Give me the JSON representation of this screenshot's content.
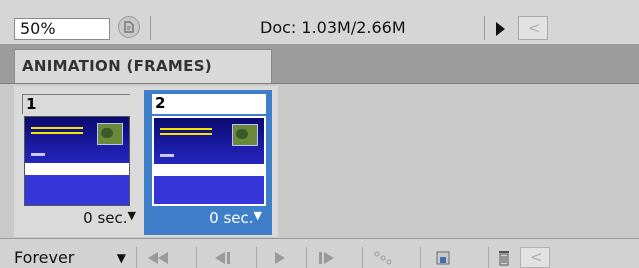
{
  "status_bar": {
    "zoom_value": "50%",
    "doc_info": "Doc: 1.03M/2.66M"
  },
  "panel": {
    "tab_title": "ANIMATION (FRAMES)",
    "frames": [
      {
        "number": "1",
        "delay": "0 sec.",
        "selected": false
      },
      {
        "number": "2",
        "delay": "0 sec.",
        "selected": true
      }
    ]
  },
  "toolbar": {
    "loop_option": "Forever",
    "buttons": [
      "first-frame-icon",
      "previous-frame-icon",
      "play-icon",
      "next-frame-icon",
      "tween-icon",
      "duplicate-frame-icon",
      "delete-frame-icon"
    ]
  },
  "colors": {
    "selected_frame": "#3f7ec8",
    "panel_bg": "#d6d6d6"
  }
}
